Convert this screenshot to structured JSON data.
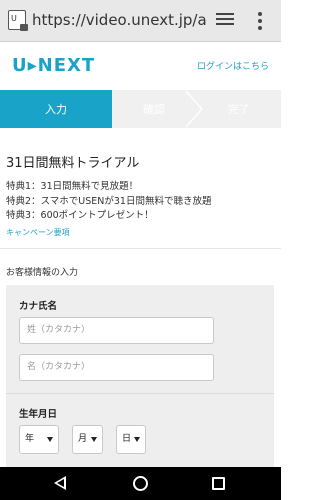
{
  "browser": {
    "url": "https://video.unext.jp/acc",
    "site_icon_label": "U"
  },
  "header": {
    "logo": "U▸NEXT",
    "login_link": "ログインはこちら"
  },
  "steps": [
    {
      "label": "入力",
      "active": true
    },
    {
      "label": "確認",
      "active": false
    },
    {
      "label": "完了",
      "active": false
    }
  ],
  "campaign": {
    "title": "31日間無料トライアル",
    "benefits": [
      "特典1：31日間無料で見放題！",
      "特典2：スマホでUSENが31日間無料で聴き放題",
      "特典3：600ポイントプレゼント！"
    ],
    "terms_link": "キャンペーン要項"
  },
  "customer_section": {
    "title": "お客様情報の入力",
    "kana_label": "カナ氏名",
    "last_name_placeholder": "姓（カタカナ）",
    "first_name_placeholder": "名（カタカナ）",
    "dob_label": "生年月日",
    "year_select": "年",
    "month_select": "月",
    "day_select": "日"
  },
  "colors": {
    "accent": "#1aa3c8",
    "step_inactive_bg": "#f0f0f0",
    "panel_bg": "#eeeeee"
  },
  "icons": {
    "tabs": "tabs-icon",
    "menu": "overflow-menu-icon",
    "back": "nav-back-icon",
    "home": "nav-home-icon",
    "recent": "nav-recent-apps-icon"
  }
}
